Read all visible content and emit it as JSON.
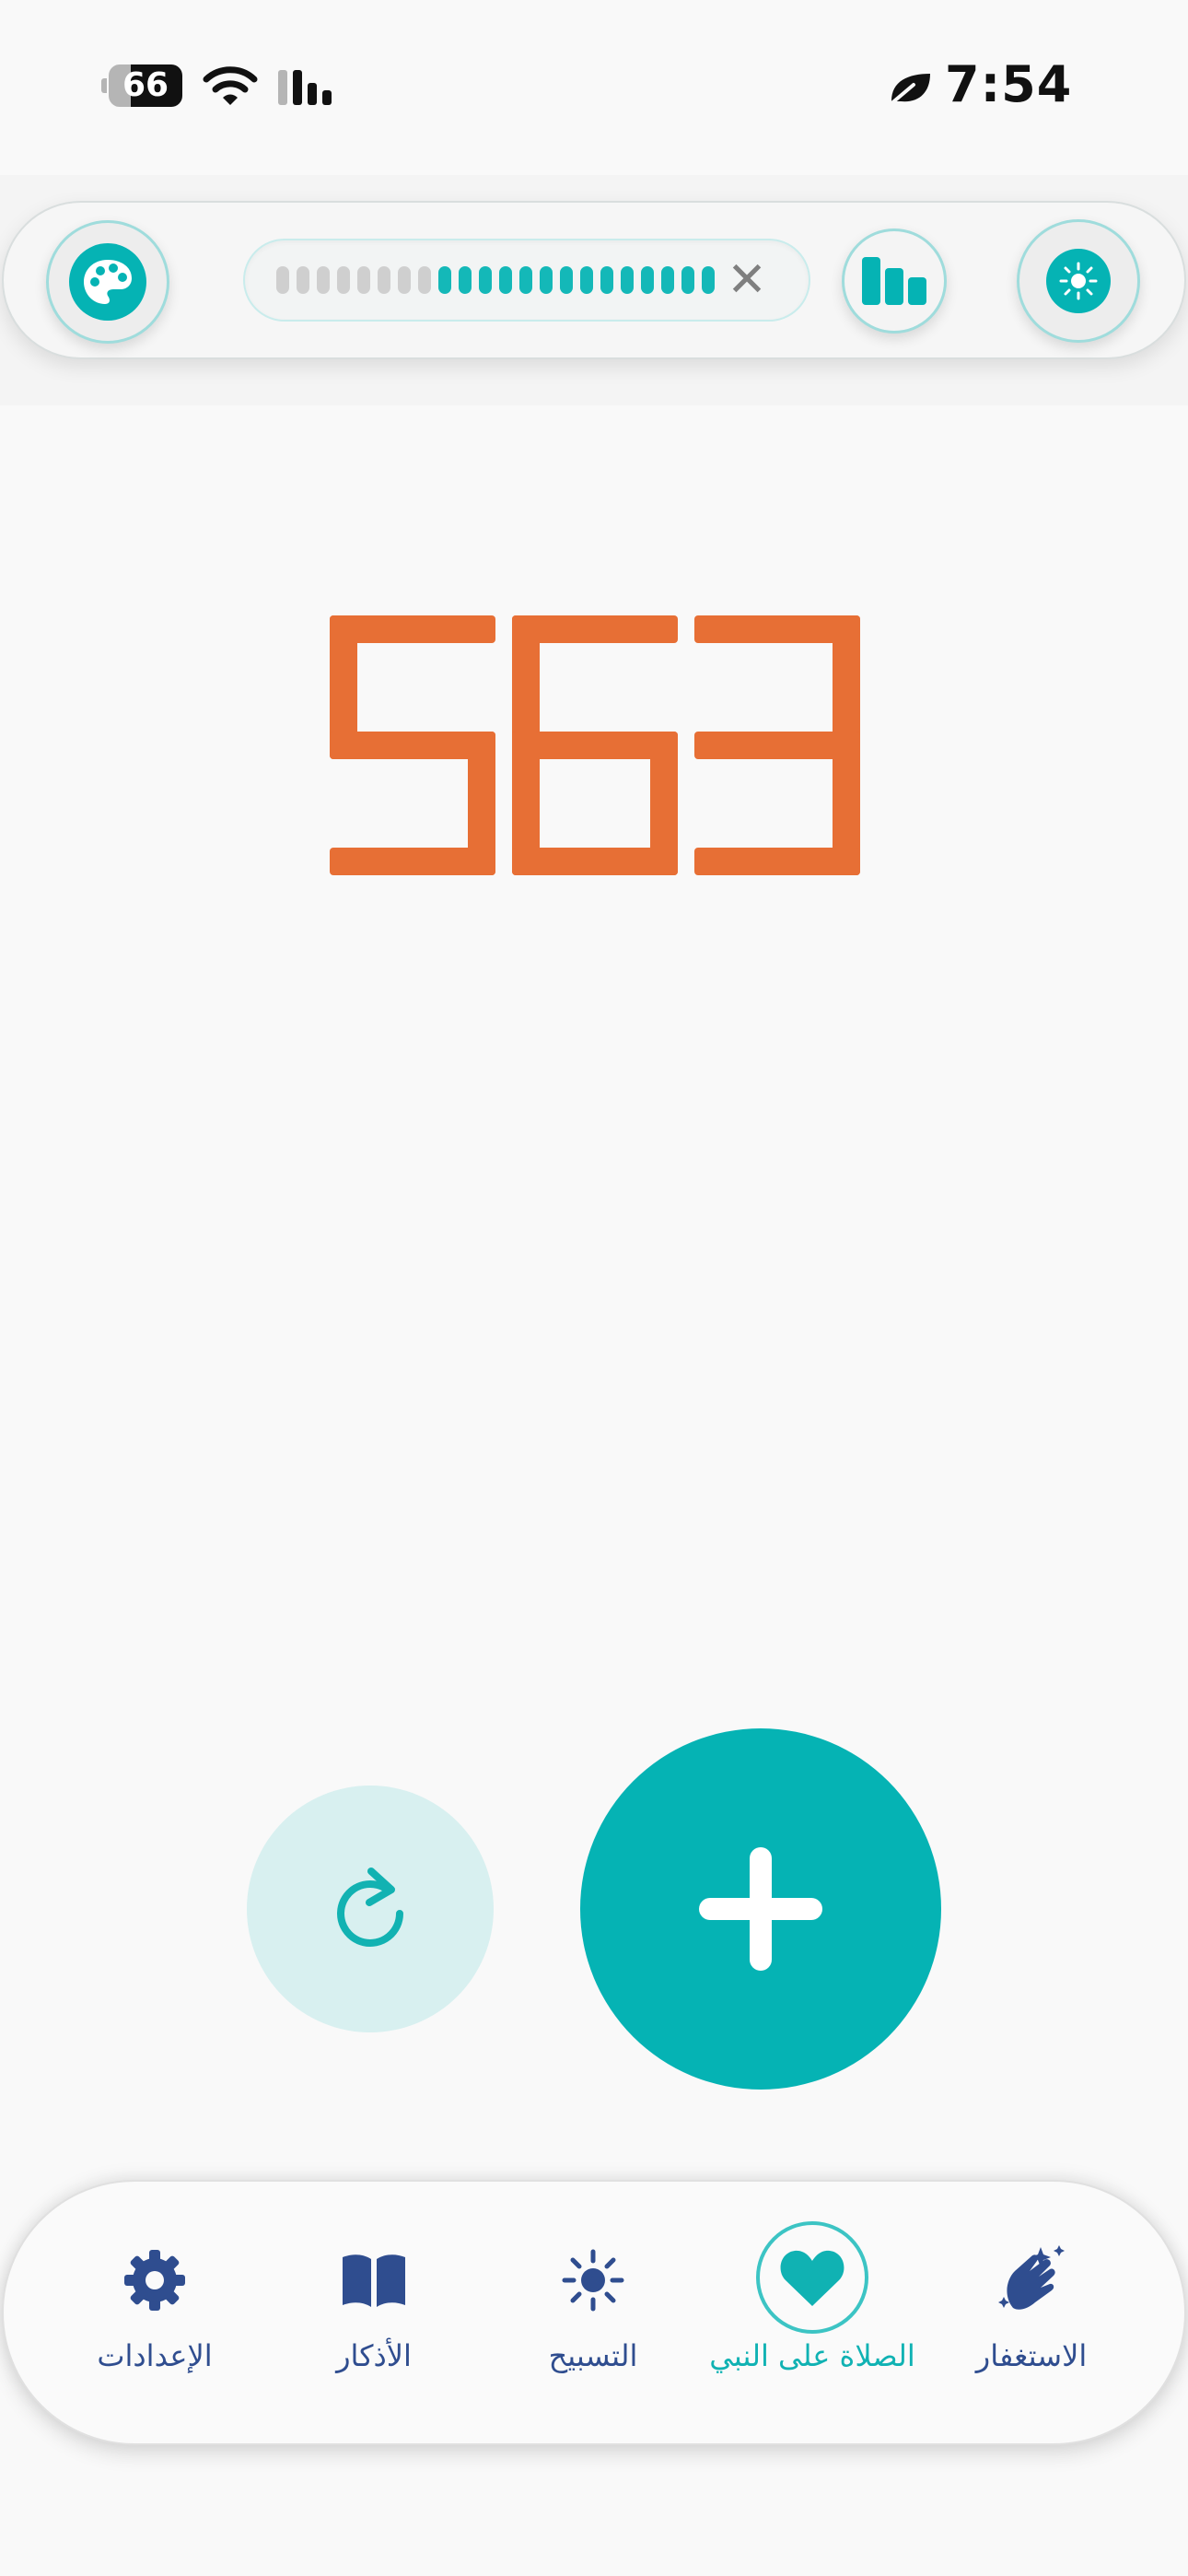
{
  "status_bar": {
    "time": "7:54",
    "battery_level": "66",
    "icons": [
      "wifi-icon",
      "cellular-signal-icon",
      "leaf-icon"
    ]
  },
  "toolbar": {
    "left_button_icon": "palette-icon",
    "progress": {
      "filled_segments": 14,
      "total_segments": 22
    },
    "close_label": "✕",
    "stats_button_icon": "bar-chart-icon",
    "right_button_icon": "sun-icon"
  },
  "counter": {
    "value": "563",
    "color": "#e76f35"
  },
  "actions": {
    "reset_icon": "refresh-icon",
    "add_icon": "plus-icon"
  },
  "bottom_nav": {
    "items": [
      {
        "label": "الاستغفار",
        "icon": "praying-hands-icon",
        "active": false
      },
      {
        "label": "الصلاة على النبي",
        "icon": "heart-icon",
        "active": true
      },
      {
        "label": "التسبيح",
        "icon": "sun-icon",
        "active": false
      },
      {
        "label": "الأذكار",
        "icon": "book-icon",
        "active": false
      },
      {
        "label": "الإعدادات",
        "icon": "gear-icon",
        "active": false
      }
    ]
  },
  "colors": {
    "accent": "#05b3b4",
    "nav_text": "#2f4d8f",
    "counter": "#e76f35"
  }
}
